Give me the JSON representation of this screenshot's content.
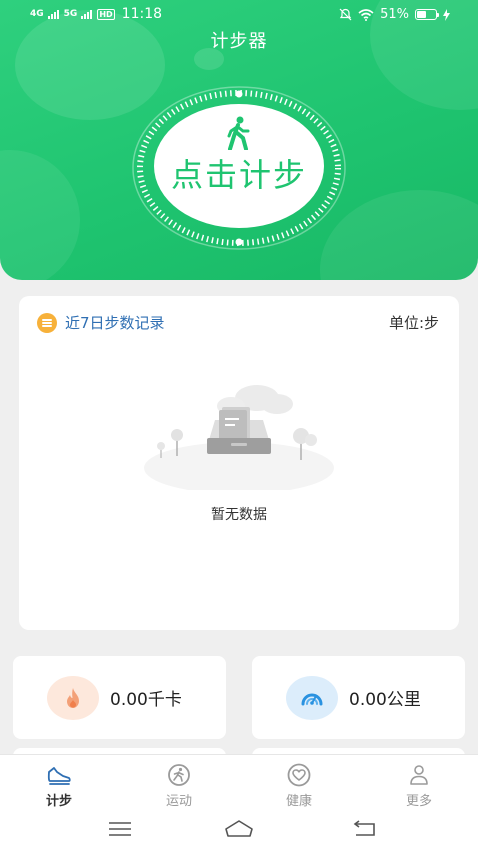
{
  "status_bar": {
    "network_1": "4G",
    "network_2": "5G",
    "hd_badge": "HD",
    "time": "11:18",
    "battery": "51%",
    "battery_level": 0.51,
    "icons": [
      "signal-icon",
      "mute-icon",
      "wifi-icon",
      "battery-icon",
      "charging-icon"
    ]
  },
  "header": {
    "title": "计步器",
    "start_button_label": "点击计步",
    "icon": "walker-icon"
  },
  "record_card": {
    "title": "近7日步数记录",
    "unit": "单位:步",
    "empty_text": "暂无数据",
    "icon": "list-icon"
  },
  "stats": {
    "calories": {
      "value": "0.00千卡",
      "icon": "flame-icon"
    },
    "distance": {
      "value": "0.00公里",
      "icon": "gauge-icon"
    }
  },
  "bottom_nav": {
    "active": "计步",
    "items": [
      {
        "label": "计步",
        "icon": "shoe-icon"
      },
      {
        "label": "运动",
        "icon": "running-icon"
      },
      {
        "label": "健康",
        "icon": "heart-icon"
      },
      {
        "label": "更多",
        "icon": "person-icon"
      }
    ]
  },
  "colors": {
    "primary_green": "#1fc470",
    "title_blue": "#2f6fb3",
    "accent_orange": "#f7b13a",
    "calorie_bg": "#fde8dc",
    "distance_bg": "#dcedfb",
    "inactive_gray": "#9a9a9a"
  }
}
